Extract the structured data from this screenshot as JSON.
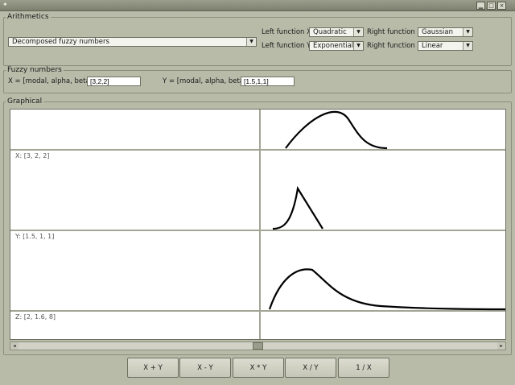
{
  "window": {
    "minimize_glyph": "▁",
    "maximize_glyph": "□",
    "close_glyph": "×"
  },
  "arithmetics": {
    "legend": "Arithmetics",
    "mode_combo": "Decomposed fuzzy numbers",
    "left_x_label": "Left function X",
    "left_x_value": "Quadratic",
    "right_x_label": "Right function X",
    "right_x_value": "Gaussian",
    "left_y_label": "Left function Y",
    "left_y_value": "Exponential",
    "right_y_label": "Right function Y",
    "right_y_value": "Linear"
  },
  "fuzzy_numbers": {
    "legend": "Fuzzy numbers",
    "x_label": "X = [modal, alpha, beta]",
    "x_value": "[3,2,2]",
    "y_label": "Y = [modal, alpha, beta]",
    "y_value": "[1.5,1,1]"
  },
  "graphical": {
    "legend": "Graphical",
    "rows": [
      {
        "label": "X: [3, 2, 2]"
      },
      {
        "label": "Y: [1.5, 1, 1]"
      },
      {
        "label": "Z: [2, 1.6, 8]"
      }
    ]
  },
  "scrollbar": {
    "left_arrow": "◂",
    "right_arrow": "▸"
  },
  "buttons": {
    "add": "X + Y",
    "subtract": "X - Y",
    "multiply": "X * Y",
    "divide": "X / Y",
    "reciprocal": "1 / X"
  },
  "colors": {
    "background": "#b9bba9",
    "plot_background": "#ffffff",
    "curve": "#000000"
  }
}
